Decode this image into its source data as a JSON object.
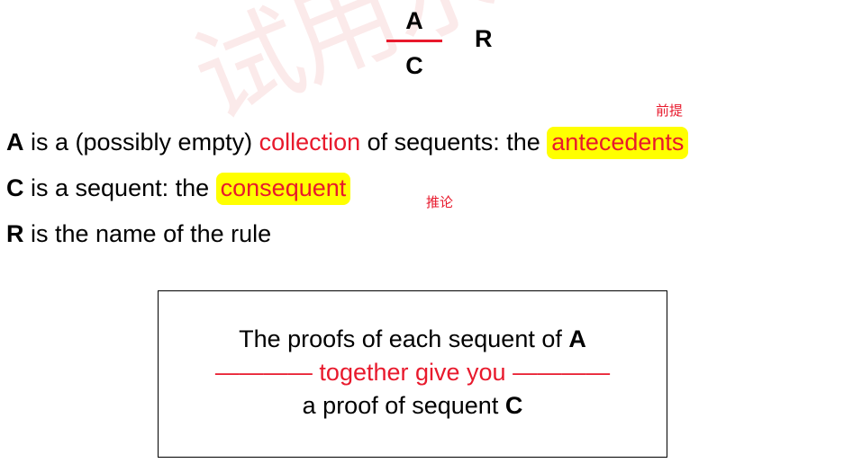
{
  "watermark": "试用水印",
  "rule": {
    "premise": "A",
    "conclusion": "C",
    "name": "R"
  },
  "notes": {
    "antecedents_cn": "前提",
    "consequent_cn": "推论"
  },
  "lines": {
    "line1": {
      "bold": "A",
      "text1": " is a (possibly empty) ",
      "red": "collection",
      "text2": " of sequents: the ",
      "highlight": "antecedents"
    },
    "line2": {
      "bold": "C",
      "text1": " is a sequent: the ",
      "highlight": "consequent"
    },
    "line3": {
      "bold": "R",
      "text1": " is the name of the rule"
    }
  },
  "box": {
    "line1_text": "The proofs of each sequent of ",
    "line1_bold": "A",
    "line2": "———— together give you ————",
    "line3_text": "a proof of sequent ",
    "line3_bold": "C"
  },
  "colors": {
    "accent_red": "#e8192c",
    "highlight_yellow": "#ffff00"
  }
}
